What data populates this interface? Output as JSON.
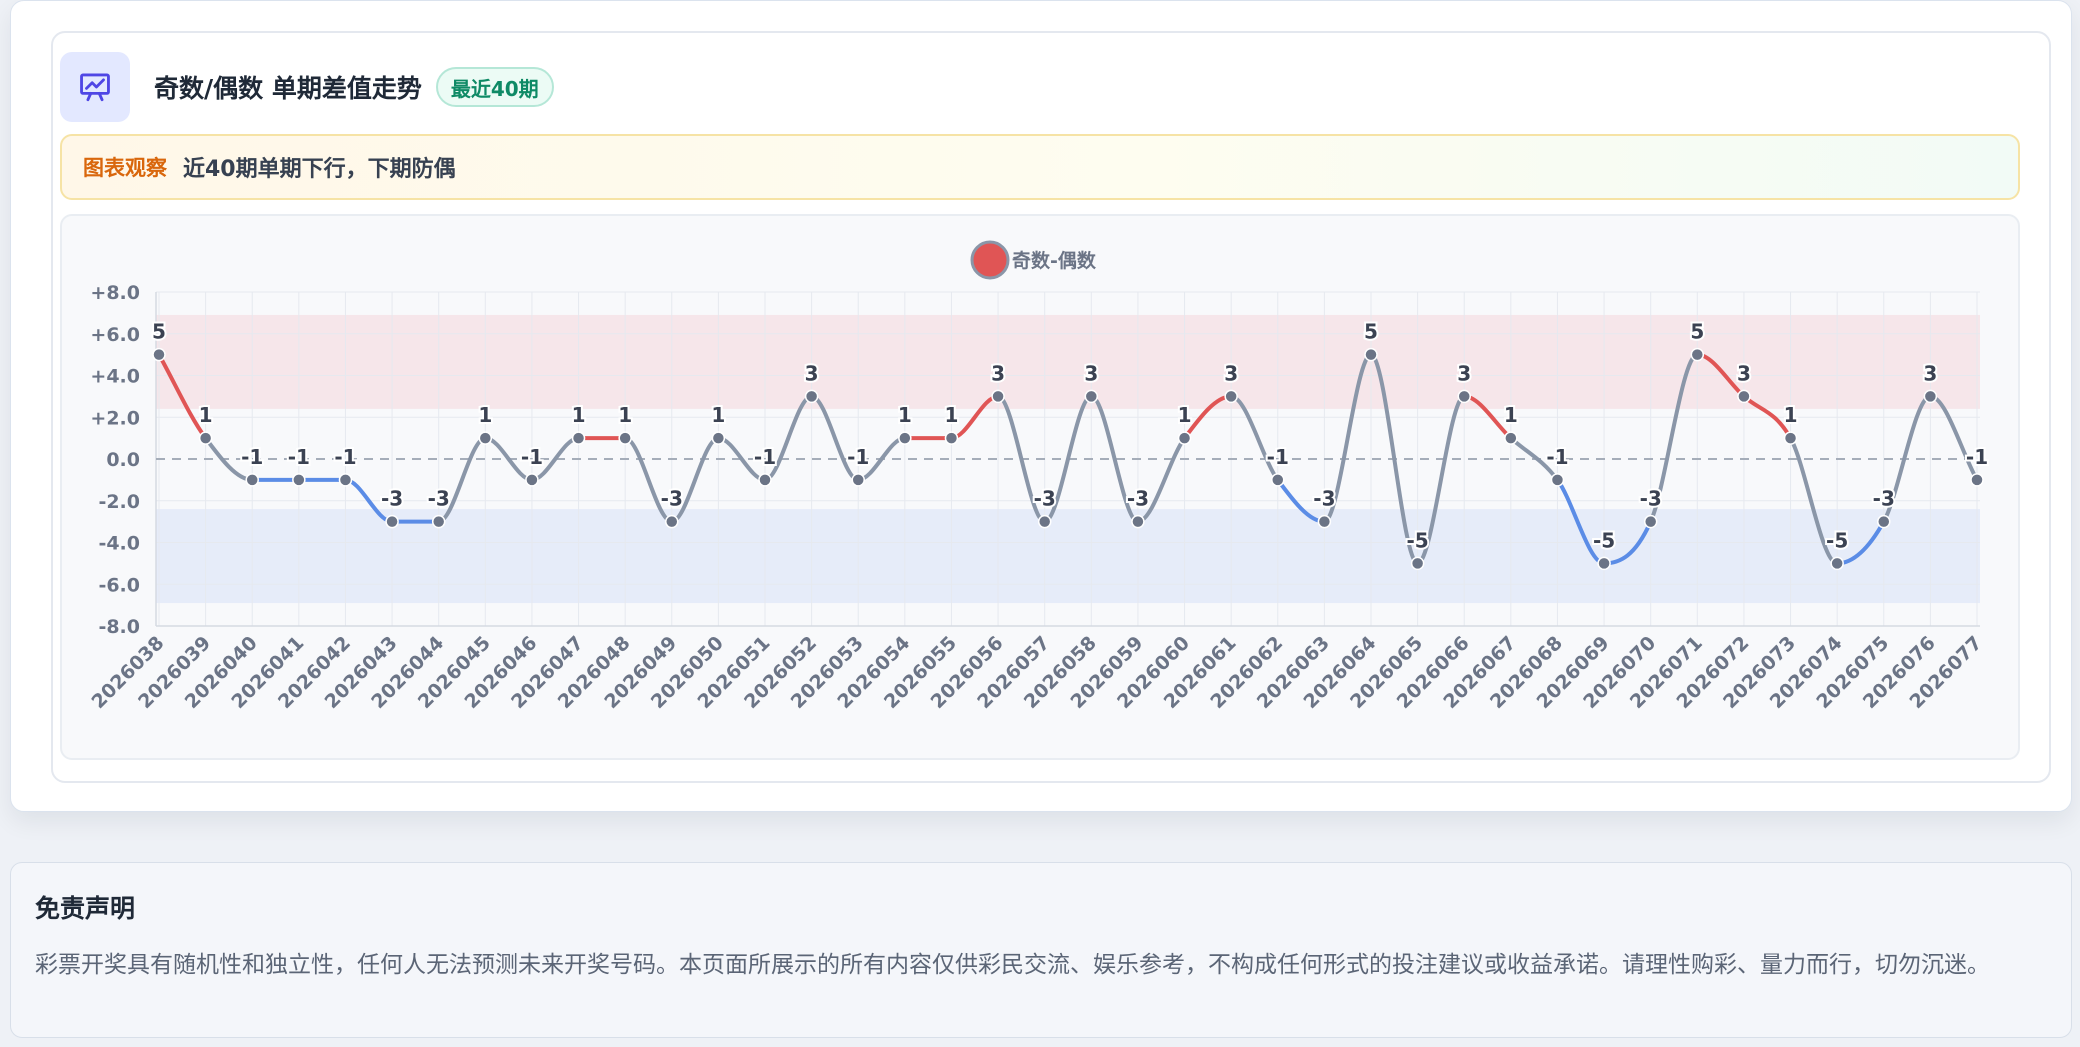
{
  "header": {
    "title": "奇数/偶数 单期差值走势",
    "badge": "最近40期",
    "icon": "chart-presentation-icon"
  },
  "observation": {
    "label": "图表观察",
    "text": "近40期单期下行，下期防偶"
  },
  "chart_data": {
    "type": "line",
    "legend": {
      "label": "奇数-偶数",
      "position": "top-center",
      "color": "#e04848"
    },
    "categories": [
      "2026038",
      "2026039",
      "2026040",
      "2026041",
      "2026042",
      "2026043",
      "2026044",
      "2026045",
      "2026046",
      "2026047",
      "2026048",
      "2026049",
      "2026050",
      "2026051",
      "2026052",
      "2026053",
      "2026054",
      "2026055",
      "2026056",
      "2026057",
      "2026058",
      "2026059",
      "2026060",
      "2026061",
      "2026062",
      "2026063",
      "2026064",
      "2026065",
      "2026066",
      "2026067",
      "2026068",
      "2026069",
      "2026070",
      "2026071",
      "2026072",
      "2026073",
      "2026074",
      "2026075",
      "2026076",
      "2026077"
    ],
    "series": [
      {
        "name": "奇数-偶数",
        "values": [
          5,
          1,
          -1,
          -1,
          -1,
          -3,
          -3,
          1,
          -1,
          1,
          1,
          -3,
          1,
          -1,
          3,
          -1,
          1,
          1,
          3,
          -3,
          3,
          -3,
          1,
          3,
          -1,
          -3,
          5,
          -5,
          3,
          1,
          -1,
          -5,
          -3,
          5,
          3,
          1,
          -5,
          -3,
          3,
          -1
        ]
      }
    ],
    "ylim": [
      -8,
      8
    ],
    "yticks": [
      8,
      6,
      4,
      2,
      0,
      -2,
      -4,
      -6,
      -8
    ],
    "ytick_labels": [
      "+8.0",
      "+6.0",
      "+4.0",
      "+2.0",
      "0.0",
      "-2.0",
      "-4.0",
      "-6.0",
      "-8.0"
    ],
    "bands": [
      {
        "from": 2.4,
        "to": 6.9,
        "color": "#f6e6ea"
      },
      {
        "from": -6.9,
        "to": -2.4,
        "color": "#e6ecf9"
      }
    ],
    "colors": {
      "up": "#e05555",
      "down": "#5b8ce6",
      "neutral": "#8a96a8",
      "point": "#6b7486"
    },
    "grid": true,
    "zero_line": "dashed"
  },
  "disclaimer": {
    "title": "免责声明",
    "text": "彩票开奖具有随机性和独立性，任何人无法预测未来开奖号码。本页面所展示的所有内容仅供彩民交流、娱乐参考，不构成任何形式的投注建议或收益承诺。请理性购彩、量力而行，切勿沉迷。"
  }
}
